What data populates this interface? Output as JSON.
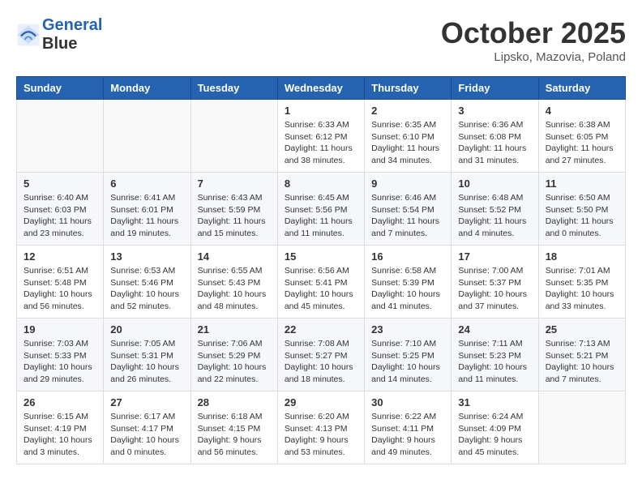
{
  "header": {
    "logo_line1": "General",
    "logo_line2": "Blue",
    "month": "October 2025",
    "location": "Lipsko, Mazovia, Poland"
  },
  "weekdays": [
    "Sunday",
    "Monday",
    "Tuesday",
    "Wednesday",
    "Thursday",
    "Friday",
    "Saturday"
  ],
  "weeks": [
    [
      {
        "day": "",
        "info": ""
      },
      {
        "day": "",
        "info": ""
      },
      {
        "day": "",
        "info": ""
      },
      {
        "day": "1",
        "info": "Sunrise: 6:33 AM\nSunset: 6:12 PM\nDaylight: 11 hours\nand 38 minutes."
      },
      {
        "day": "2",
        "info": "Sunrise: 6:35 AM\nSunset: 6:10 PM\nDaylight: 11 hours\nand 34 minutes."
      },
      {
        "day": "3",
        "info": "Sunrise: 6:36 AM\nSunset: 6:08 PM\nDaylight: 11 hours\nand 31 minutes."
      },
      {
        "day": "4",
        "info": "Sunrise: 6:38 AM\nSunset: 6:05 PM\nDaylight: 11 hours\nand 27 minutes."
      }
    ],
    [
      {
        "day": "5",
        "info": "Sunrise: 6:40 AM\nSunset: 6:03 PM\nDaylight: 11 hours\nand 23 minutes."
      },
      {
        "day": "6",
        "info": "Sunrise: 6:41 AM\nSunset: 6:01 PM\nDaylight: 11 hours\nand 19 minutes."
      },
      {
        "day": "7",
        "info": "Sunrise: 6:43 AM\nSunset: 5:59 PM\nDaylight: 11 hours\nand 15 minutes."
      },
      {
        "day": "8",
        "info": "Sunrise: 6:45 AM\nSunset: 5:56 PM\nDaylight: 11 hours\nand 11 minutes."
      },
      {
        "day": "9",
        "info": "Sunrise: 6:46 AM\nSunset: 5:54 PM\nDaylight: 11 hours\nand 7 minutes."
      },
      {
        "day": "10",
        "info": "Sunrise: 6:48 AM\nSunset: 5:52 PM\nDaylight: 11 hours\nand 4 minutes."
      },
      {
        "day": "11",
        "info": "Sunrise: 6:50 AM\nSunset: 5:50 PM\nDaylight: 11 hours\nand 0 minutes."
      }
    ],
    [
      {
        "day": "12",
        "info": "Sunrise: 6:51 AM\nSunset: 5:48 PM\nDaylight: 10 hours\nand 56 minutes."
      },
      {
        "day": "13",
        "info": "Sunrise: 6:53 AM\nSunset: 5:46 PM\nDaylight: 10 hours\nand 52 minutes."
      },
      {
        "day": "14",
        "info": "Sunrise: 6:55 AM\nSunset: 5:43 PM\nDaylight: 10 hours\nand 48 minutes."
      },
      {
        "day": "15",
        "info": "Sunrise: 6:56 AM\nSunset: 5:41 PM\nDaylight: 10 hours\nand 45 minutes."
      },
      {
        "day": "16",
        "info": "Sunrise: 6:58 AM\nSunset: 5:39 PM\nDaylight: 10 hours\nand 41 minutes."
      },
      {
        "day": "17",
        "info": "Sunrise: 7:00 AM\nSunset: 5:37 PM\nDaylight: 10 hours\nand 37 minutes."
      },
      {
        "day": "18",
        "info": "Sunrise: 7:01 AM\nSunset: 5:35 PM\nDaylight: 10 hours\nand 33 minutes."
      }
    ],
    [
      {
        "day": "19",
        "info": "Sunrise: 7:03 AM\nSunset: 5:33 PM\nDaylight: 10 hours\nand 29 minutes."
      },
      {
        "day": "20",
        "info": "Sunrise: 7:05 AM\nSunset: 5:31 PM\nDaylight: 10 hours\nand 26 minutes."
      },
      {
        "day": "21",
        "info": "Sunrise: 7:06 AM\nSunset: 5:29 PM\nDaylight: 10 hours\nand 22 minutes."
      },
      {
        "day": "22",
        "info": "Sunrise: 7:08 AM\nSunset: 5:27 PM\nDaylight: 10 hours\nand 18 minutes."
      },
      {
        "day": "23",
        "info": "Sunrise: 7:10 AM\nSunset: 5:25 PM\nDaylight: 10 hours\nand 14 minutes."
      },
      {
        "day": "24",
        "info": "Sunrise: 7:11 AM\nSunset: 5:23 PM\nDaylight: 10 hours\nand 11 minutes."
      },
      {
        "day": "25",
        "info": "Sunrise: 7:13 AM\nSunset: 5:21 PM\nDaylight: 10 hours\nand 7 minutes."
      }
    ],
    [
      {
        "day": "26",
        "info": "Sunrise: 6:15 AM\nSunset: 4:19 PM\nDaylight: 10 hours\nand 3 minutes."
      },
      {
        "day": "27",
        "info": "Sunrise: 6:17 AM\nSunset: 4:17 PM\nDaylight: 10 hours\nand 0 minutes."
      },
      {
        "day": "28",
        "info": "Sunrise: 6:18 AM\nSunset: 4:15 PM\nDaylight: 9 hours\nand 56 minutes."
      },
      {
        "day": "29",
        "info": "Sunrise: 6:20 AM\nSunset: 4:13 PM\nDaylight: 9 hours\nand 53 minutes."
      },
      {
        "day": "30",
        "info": "Sunrise: 6:22 AM\nSunset: 4:11 PM\nDaylight: 9 hours\nand 49 minutes."
      },
      {
        "day": "31",
        "info": "Sunrise: 6:24 AM\nSunset: 4:09 PM\nDaylight: 9 hours\nand 45 minutes."
      },
      {
        "day": "",
        "info": ""
      }
    ]
  ]
}
